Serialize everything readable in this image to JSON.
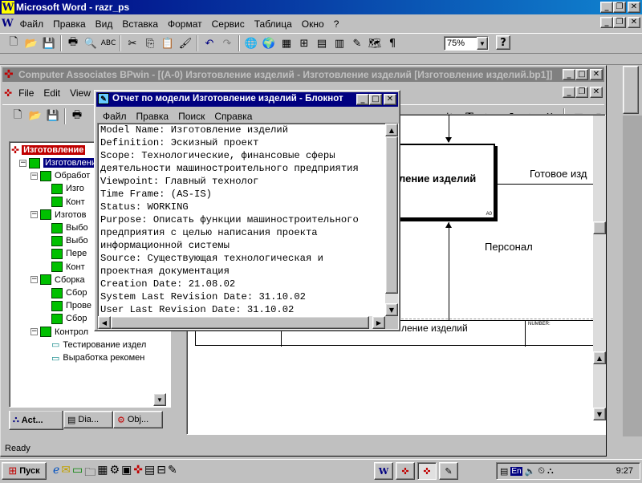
{
  "word": {
    "title": "Microsoft Word - razr_ps",
    "menu": [
      "Файл",
      "Правка",
      "Вид",
      "Вставка",
      "Формат",
      "Сервис",
      "Таблица",
      "Окно",
      "?"
    ],
    "zoom": "75%"
  },
  "bpwin": {
    "title": "Computer Associates BPwin - [(A-0) Изготовление изделий - Изготовление изделий  [Изготовление изделий.bp1]]",
    "menu": [
      "File",
      "Edit",
      "View"
    ],
    "tree": {
      "root": "Изготовление",
      "items": [
        {
          "label": "Изготовление",
          "level": 1,
          "kind": "expanded",
          "selected": true
        },
        {
          "label": "Обработ",
          "level": 2,
          "kind": "expanded"
        },
        {
          "label": "Изго",
          "level": 3,
          "kind": "leaf"
        },
        {
          "label": "Конт",
          "level": 3,
          "kind": "leaf"
        },
        {
          "label": "Изготов",
          "level": 2,
          "kind": "expanded"
        },
        {
          "label": "Выбо",
          "level": 3,
          "kind": "leaf"
        },
        {
          "label": "Выбо",
          "level": 3,
          "kind": "leaf"
        },
        {
          "label": "Пере",
          "level": 3,
          "kind": "leaf"
        },
        {
          "label": "Конт",
          "level": 3,
          "kind": "leaf"
        },
        {
          "label": "Сборка",
          "level": 2,
          "kind": "expanded"
        },
        {
          "label": "Сбор",
          "level": 3,
          "kind": "leaf"
        },
        {
          "label": "Прове",
          "level": 3,
          "kind": "leaf"
        },
        {
          "label": "Сбор",
          "level": 3,
          "kind": "leaf"
        },
        {
          "label": "Контрол",
          "level": 2,
          "kind": "expanded"
        },
        {
          "label": "Тестирование издел",
          "level": 3,
          "kind": "doc"
        },
        {
          "label": "Выработка рекомен",
          "level": 3,
          "kind": "doc"
        }
      ]
    },
    "tabs": [
      "Act...",
      "Dia...",
      "Obj..."
    ],
    "status": "Ready",
    "diagram": {
      "box_text": "ление изделий",
      "output_label": "Готовое изд",
      "mechanism_label": "Персонал",
      "footer_title": "ление изделий",
      "footer_number": "NUMBER:",
      "box_corner": "A0"
    }
  },
  "notepad": {
    "title": "Отчет по модели Изготовление изделий - Блокнот",
    "menu": [
      "Файл",
      "Правка",
      "Поиск",
      "Справка"
    ],
    "lines": [
      "Model Name: Изготовление изделий",
      "Definition: Эскизный проект",
      "Scope: Технологические, финансовые сферы",
      "деятельности машиностроительного предприятия",
      "Viewpoint: Главный технолог",
      "Time Frame: (AS-IS)",
      "Status: WORKING",
      "Purpose: Описать функции машиностроительного",
      "предприятия с целью написания проекта",
      "информационной системы",
      "Source: Существующая технологическая и",
      "проектная документация",
      "Creation Date: 21.08.02",
      "System Last Revision Date: 31.10.02",
      "User Last Revision Date: 31.10.02"
    ]
  },
  "taskbar": {
    "start": "Пуск",
    "lang": "En",
    "clock": "9:27"
  }
}
